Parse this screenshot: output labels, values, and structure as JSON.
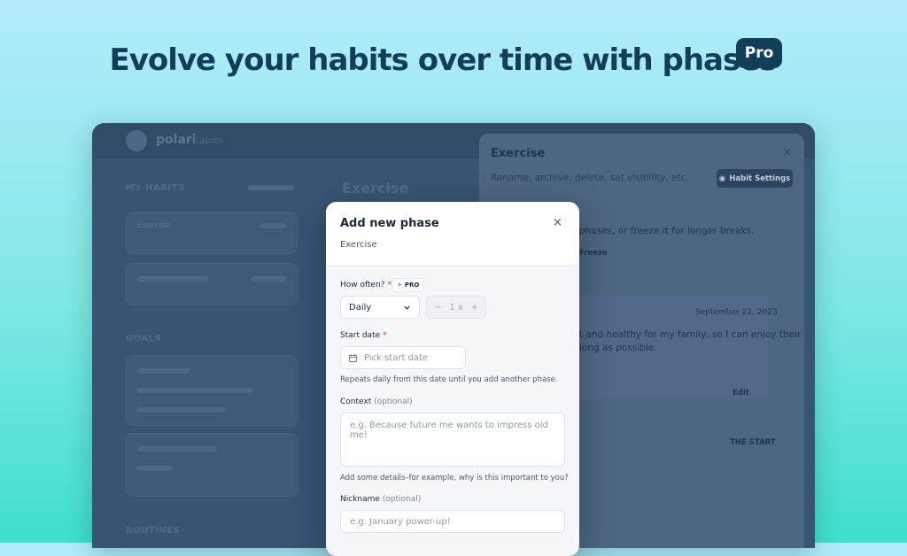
{
  "headline": "Evolve your habits over time with phases",
  "headline_badge": "Pro",
  "app": {
    "logo_text": "polari",
    "logo_sub": "habits",
    "left_heading": "MY HABITS",
    "main_title": "Exercise",
    "sidebar_item": "Exercise",
    "section_heading_2": "GOALS",
    "section_heading_3": "ROUTINES"
  },
  "panel": {
    "title": "Exercise",
    "close": "×",
    "description": "Rename, archive, delete, set visibility, etc.",
    "settings_button": "Habit Settings",
    "phases_text": "phases, or freeze it for longer breaks.",
    "freeze_label": "Freeze",
    "date": "September 22, 2023",
    "note_line1": "t and healthy for my family, so I can enjoy their",
    "note_line2": "long as possible.",
    "edit": "Edit",
    "the_start": "THE START"
  },
  "modal": {
    "title": "Add new phase",
    "subtitle": "Exercise",
    "close": "×",
    "how_often_label": "How often?",
    "required_mark": "*",
    "pro_tag": "PRO",
    "frequency_value": "Daily",
    "stepper_minus": "−",
    "stepper_value": "1 x",
    "stepper_plus": "+",
    "start_date_label": "Start date",
    "start_date_placeholder": "Pick start date",
    "start_date_hint": "Repeats daily from this date until you add another phase.",
    "context_label": "Context",
    "optional": "(optional)",
    "context_placeholder": "e.g. Because future me wants to impress old me!",
    "context_hint": "Add some details–for example, why is this important to you?",
    "nickname_label": "Nickname",
    "nickname_placeholder": "e.g. January power-up!"
  },
  "colors": {
    "headline": "#123e5a",
    "required": "#e0324b",
    "app_background": "#385473"
  }
}
